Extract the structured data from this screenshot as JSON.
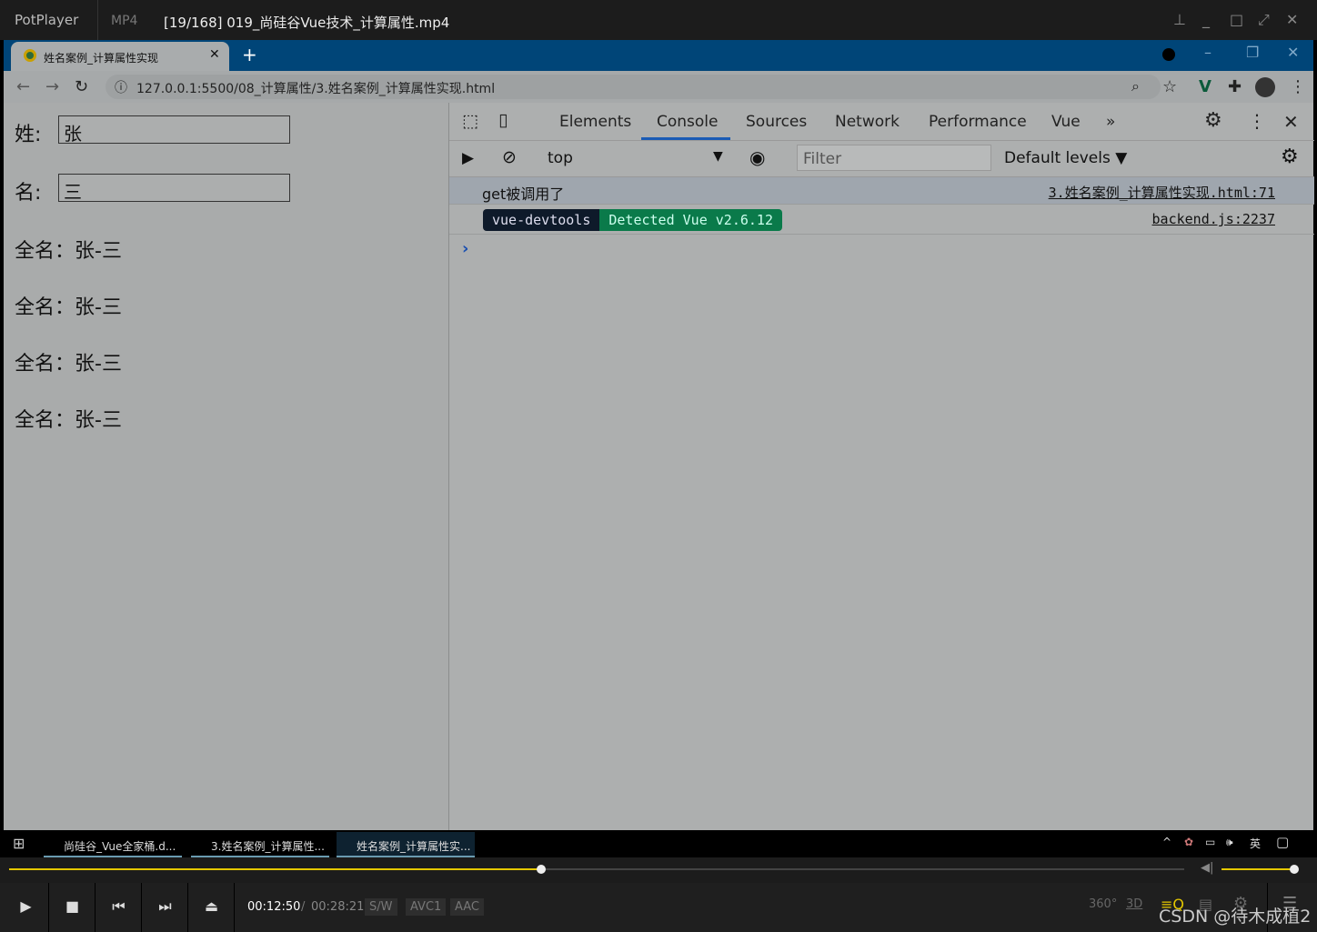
{
  "player": {
    "app": "PotPlayer",
    "format": "MP4",
    "file": "[19/168] 019_尚硅谷Vue技术_计算属性.mp4",
    "time_current": "00:12:50",
    "time_sep": "/",
    "time_total": "00:28:21",
    "tags": [
      "S/W",
      "AVC1",
      "AAC"
    ],
    "progress": 0.453,
    "volume": 1.0,
    "watermark": "CSDN @待木成植2"
  },
  "browser": {
    "tab_title": "姓名案例_计算属性实现",
    "url": "127.0.0.1:5500/08_计算属性/3.姓名案例_计算属性实现.html"
  },
  "page": {
    "last_label": "姓:",
    "last_value": "张",
    "first_label": "名:",
    "first_value": "三",
    "fullnames": [
      "全名：张-三",
      "全名：张-三",
      "全名：张-三",
      "全名：张-三"
    ]
  },
  "devtools": {
    "tabs": [
      "Elements",
      "Console",
      "Sources",
      "Network",
      "Performance",
      "Vue"
    ],
    "active_tab": "Console",
    "context": "top",
    "filter_placeholder": "Filter",
    "levels": "Default levels ▼",
    "messages": [
      {
        "text": "get被调用了",
        "source": "3.姓名案例_计算属性实现.html:71"
      },
      {
        "badge1": "vue-devtools",
        "badge2": "Detected Vue v2.6.12",
        "source": "backend.js:2237"
      }
    ],
    "prompt": "›"
  },
  "taskbar": {
    "items": [
      "尚硅谷_Vue全家桶.d...",
      "3.姓名案例_计算属性...",
      "姓名案例_计算属性实..."
    ],
    "ime": "英"
  }
}
